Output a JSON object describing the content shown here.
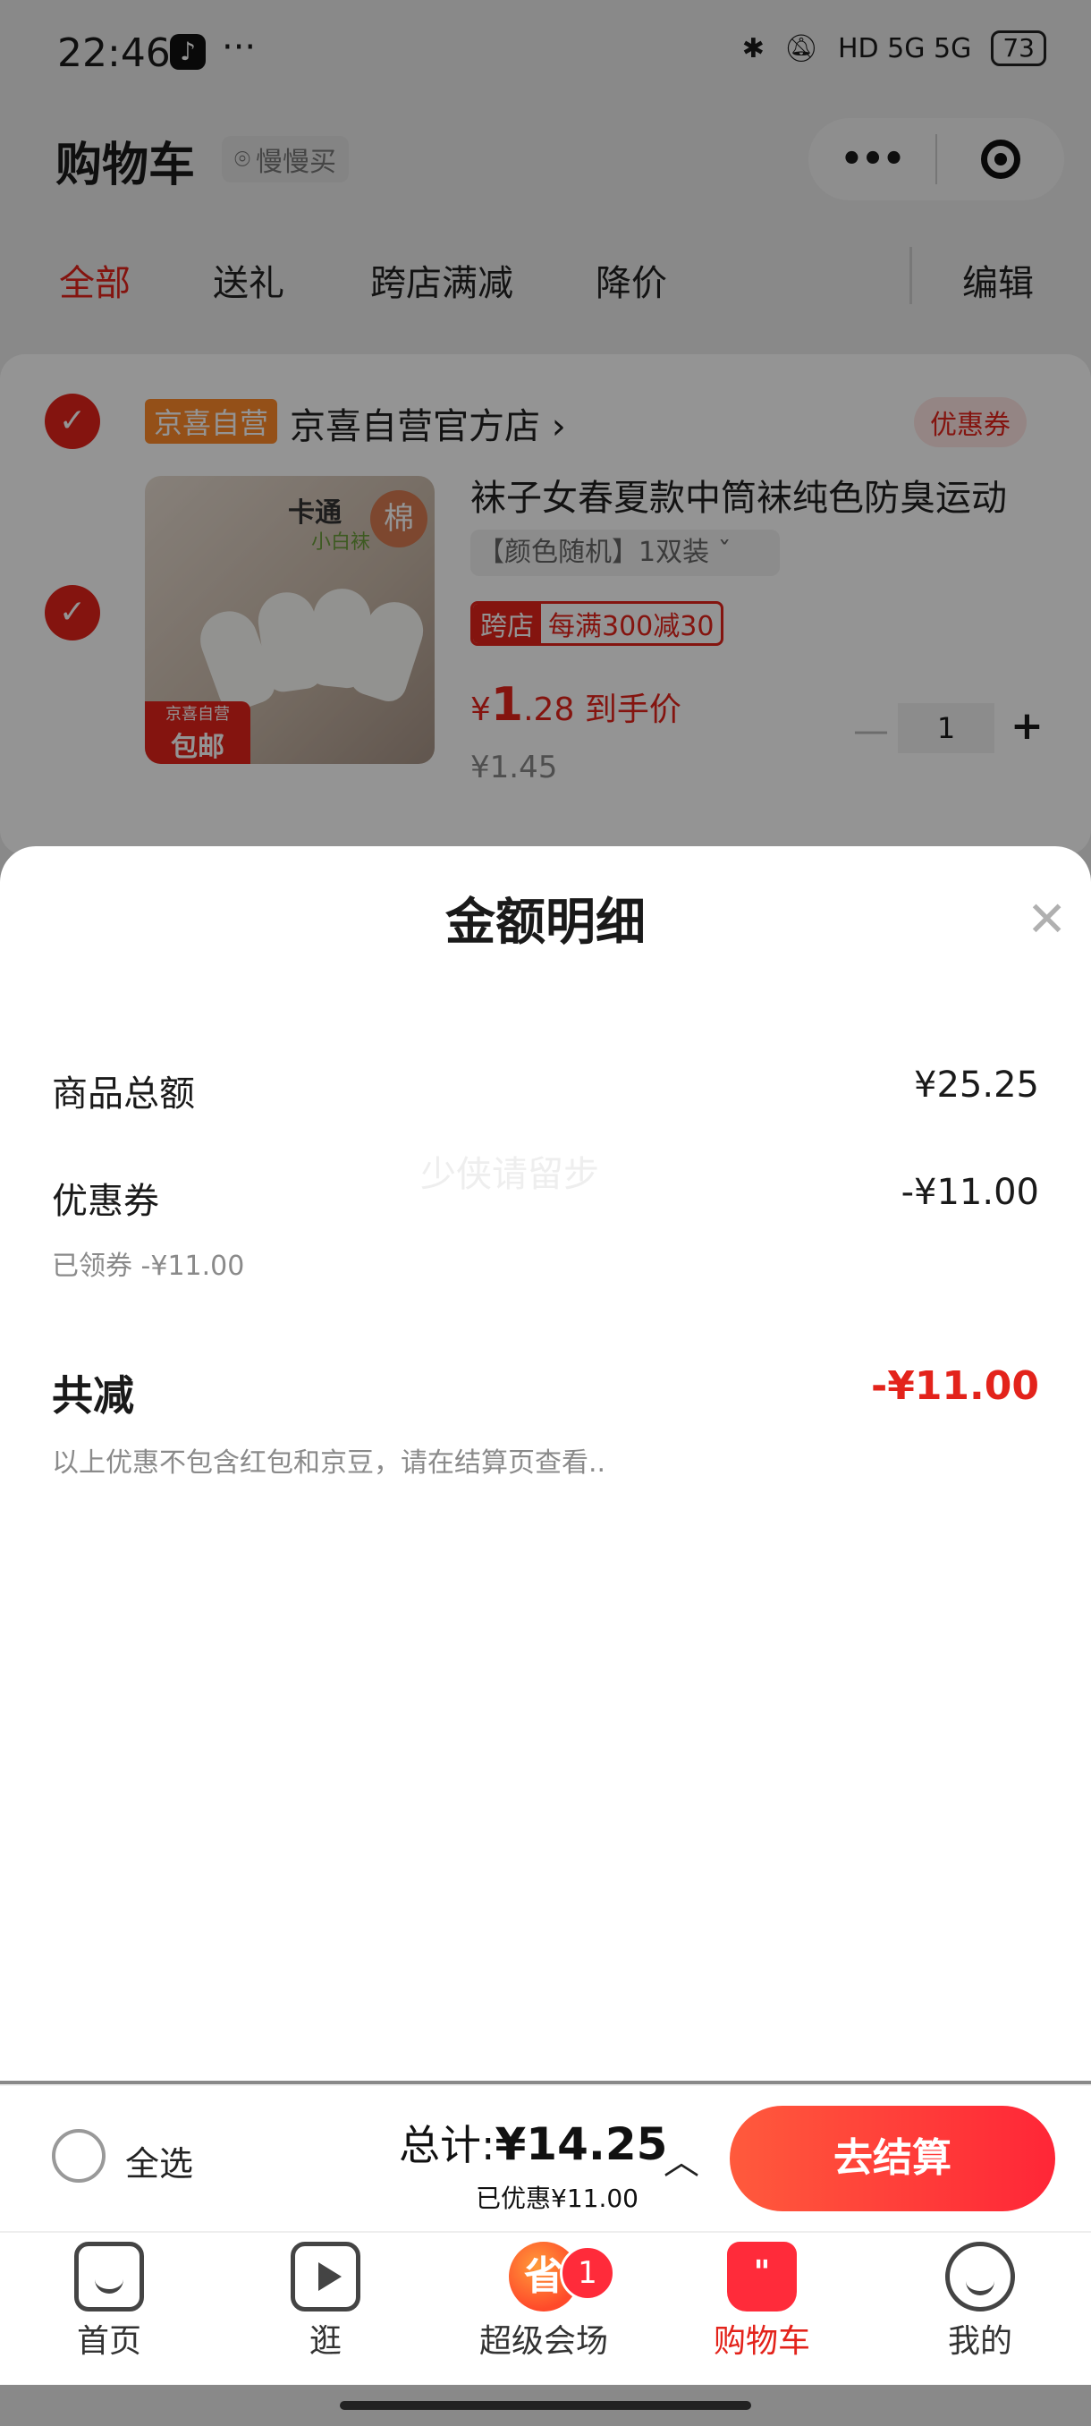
{
  "status_bar": {
    "time": "22:46",
    "more": "···",
    "network": "HD 5G 5G",
    "battery": "73"
  },
  "header": {
    "title": "购物车",
    "location": "慢慢买",
    "capsule_more": "•••"
  },
  "filter_tabs": [
    "全部",
    "送礼",
    "跨店满减",
    "降价"
  ],
  "edit_label": "编辑",
  "shop": {
    "tag": "京喜自营",
    "name": "京喜自营官方店 ›",
    "coupon": "优惠券",
    "product": {
      "image_title": "卡通",
      "image_sub": "小白袜",
      "image_badge": "棉",
      "image_ship_top": "京喜自营",
      "image_ship": "包邮",
      "title": "袜子女春夏款中筒袜纯色防臭运动",
      "spec": "【颜色随机】1双装  ˇ",
      "promo_a": "跨店",
      "promo_b": "每满300减30",
      "price_symbol": "¥",
      "price_int": "1",
      "price_dec": ".28",
      "price_suffix": "到手价",
      "orig_price": "¥1.45",
      "qty": "1"
    }
  },
  "sheet": {
    "title": "金额明细",
    "rows": [
      {
        "label": "商品总额",
        "value": "¥25.25"
      },
      {
        "label": "优惠券",
        "value": "-¥11.00",
        "sub": "已领券 -¥11.00"
      }
    ],
    "total_label": "共减",
    "total_value": "-¥11.00",
    "note": "以上优惠不包含红包和京豆，请在结算页查看..",
    "watermark": "少侠请留步"
  },
  "checkout": {
    "select_all": "全选",
    "total_label": "总计:",
    "total_value": "¥14.25",
    "saved": "已优惠¥11.00",
    "button": "去结算"
  },
  "tabbar": {
    "items": [
      {
        "label": "首页",
        "icon": "home-icon"
      },
      {
        "label": "逛",
        "icon": "video-icon"
      },
      {
        "label": "超级会场",
        "icon": "super-venue-icon",
        "glyph": "省"
      },
      {
        "label": "购物车",
        "icon": "cart-icon",
        "glyph": "\""
      },
      {
        "label": "我的",
        "icon": "profile-icon"
      }
    ],
    "badge": "1"
  },
  "colors": {
    "accent": "#e3231b",
    "checkout_button": "#ff2637"
  }
}
